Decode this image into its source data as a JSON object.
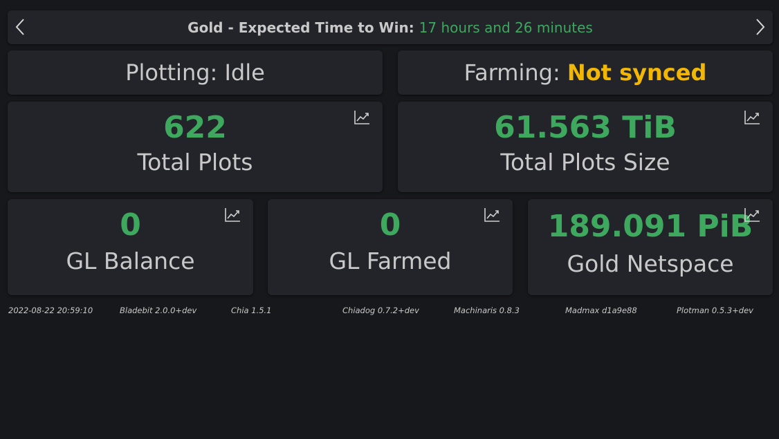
{
  "banner": {
    "label": "Gold - Expected Time to Win: ",
    "value": "17 hours and 26 minutes"
  },
  "plotting": {
    "label": "Plotting: ",
    "value": "Idle"
  },
  "farming": {
    "label": "Farming: ",
    "value": "Not synced"
  },
  "stats": {
    "total_plots": {
      "value": "622",
      "label": "Total Plots"
    },
    "total_plots_size": {
      "value": "61.563 TiB",
      "label": "Total Plots Size"
    },
    "gl_balance": {
      "value": "0",
      "label": "GL Balance"
    },
    "gl_farmed": {
      "value": "0",
      "label": "GL Farmed"
    },
    "gold_netspace": {
      "value": "189.091 PiB",
      "label": "Gold Netspace"
    }
  },
  "footer": {
    "timestamp": "2022-08-22 20:59:10",
    "bladebit": "Bladebit 2.0.0+dev",
    "chia": "Chia 1.5.1",
    "chiadog": "Chiadog 0.7.2+dev",
    "machinaris": "Machinaris 0.8.3",
    "madmax": "Madmax d1a9e88",
    "plotman": "Plotman 0.5.3+dev"
  },
  "colors": {
    "background": "#17181b",
    "card": "#222429",
    "text": "#c9c9c9",
    "success": "#3fa85f",
    "warning": "#f2b705"
  },
  "icons": {
    "prev": "chevron-left-icon",
    "next": "chevron-right-icon",
    "chart": "chart-line-icon"
  }
}
